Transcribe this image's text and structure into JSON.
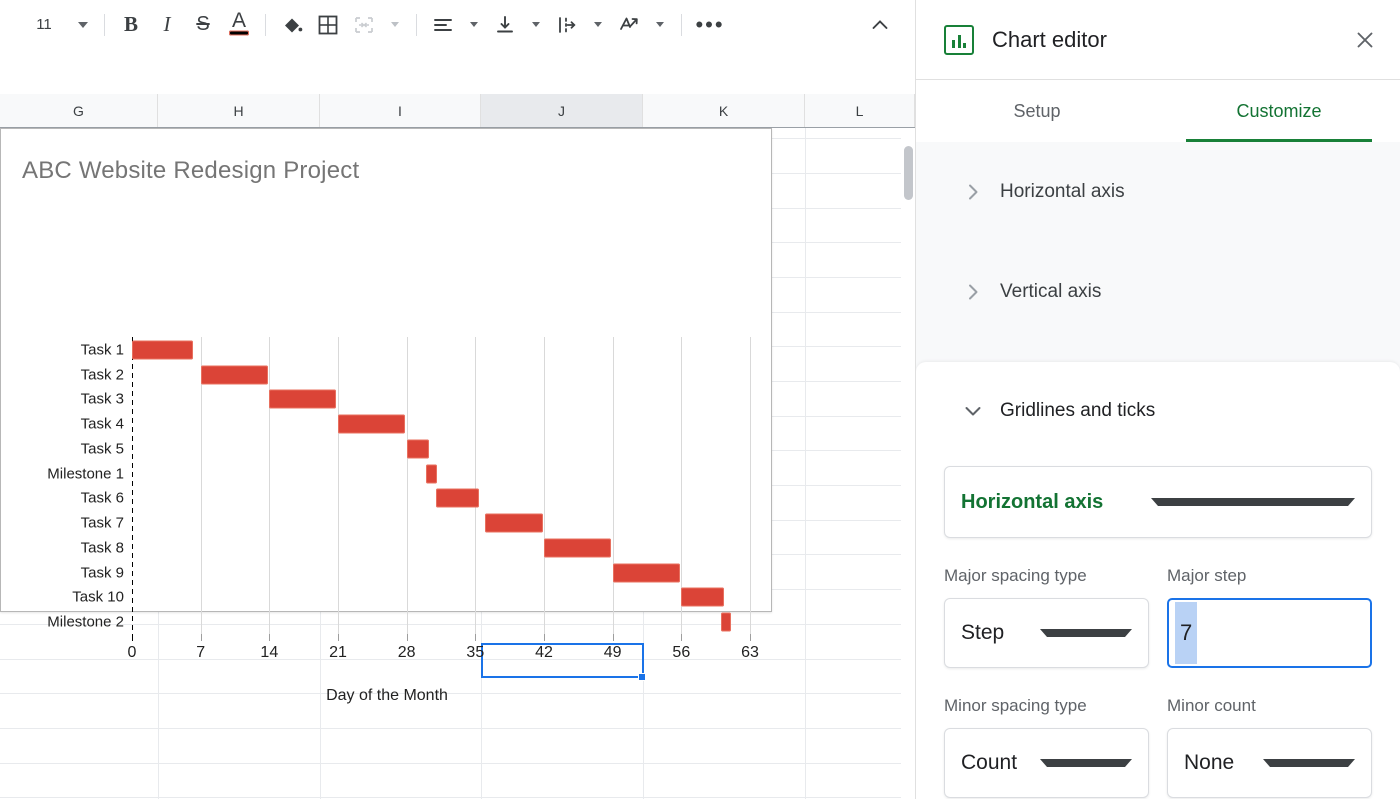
{
  "toolbar": {
    "font_size": "11",
    "bold_label": "B",
    "italic_label": "I",
    "strikethrough_label": "S",
    "text_color_label": "A",
    "more_label": "•••"
  },
  "spreadsheet": {
    "columns": [
      "G",
      "H",
      "I",
      "J",
      "K",
      "L"
    ],
    "selected_column": "J"
  },
  "chart_data": {
    "type": "bar",
    "chart_style": "gantt",
    "title": "ABC Website Redesign Project",
    "xlabel": "Day of the Month",
    "ylabel": "",
    "xlim": [
      0,
      63
    ],
    "xticks": [
      0,
      7,
      14,
      21,
      28,
      35,
      42,
      49,
      56,
      63
    ],
    "categories": [
      "Task 1",
      "Task 2",
      "Task 3",
      "Task 4",
      "Task 5",
      "Milestone 1",
      "Task 6",
      "Task 7",
      "Task 8",
      "Task 9",
      "Task 10",
      "Milestone 2"
    ],
    "bars": [
      {
        "label": "Task 1",
        "start": 0,
        "end": 6.2
      },
      {
        "label": "Task 2",
        "start": 7,
        "end": 13.9
      },
      {
        "label": "Task 3",
        "start": 14,
        "end": 20.8
      },
      {
        "label": "Task 4",
        "start": 21,
        "end": 27.8
      },
      {
        "label": "Task 5",
        "start": 28,
        "end": 30.3
      },
      {
        "label": "Milestone 1",
        "start": 30,
        "end": 31.1
      },
      {
        "label": "Task 6",
        "start": 31,
        "end": 35.4
      },
      {
        "label": "Task 7",
        "start": 36,
        "end": 41.9
      },
      {
        "label": "Task 8",
        "start": 42,
        "end": 48.8
      },
      {
        "label": "Task 9",
        "start": 49,
        "end": 55.9
      },
      {
        "label": "Task 10",
        "start": 56,
        "end": 60.4
      },
      {
        "label": "Milestone 2",
        "start": 60,
        "end": 61.1
      }
    ],
    "bar_color": "#db4437",
    "grid": true,
    "legend": "none"
  },
  "editor": {
    "title": "Chart editor",
    "icon": "bar-chart-icon",
    "close_label": "×",
    "tabs": [
      {
        "label": "Setup",
        "active": false
      },
      {
        "label": "Customize",
        "active": true
      }
    ],
    "sections": [
      {
        "label": "Horizontal axis",
        "expanded": false
      },
      {
        "label": "Vertical axis",
        "expanded": false
      },
      {
        "label": "Gridlines and ticks",
        "expanded": true
      }
    ],
    "axis_selector": {
      "value": "Horizontal axis"
    },
    "fields": [
      {
        "label": "Major spacing type",
        "value": "Step",
        "kind": "select"
      },
      {
        "label": "Major step",
        "value": "7",
        "kind": "input"
      },
      {
        "label": "Minor spacing type",
        "value": "Count",
        "kind": "select"
      },
      {
        "label": "Minor count",
        "value": "None",
        "kind": "select"
      }
    ]
  },
  "colors": {
    "accent_green": "#188038",
    "accent_blue": "#1a73e8",
    "bar_red": "#db4437",
    "panel_gray": "#f8f9fa"
  }
}
